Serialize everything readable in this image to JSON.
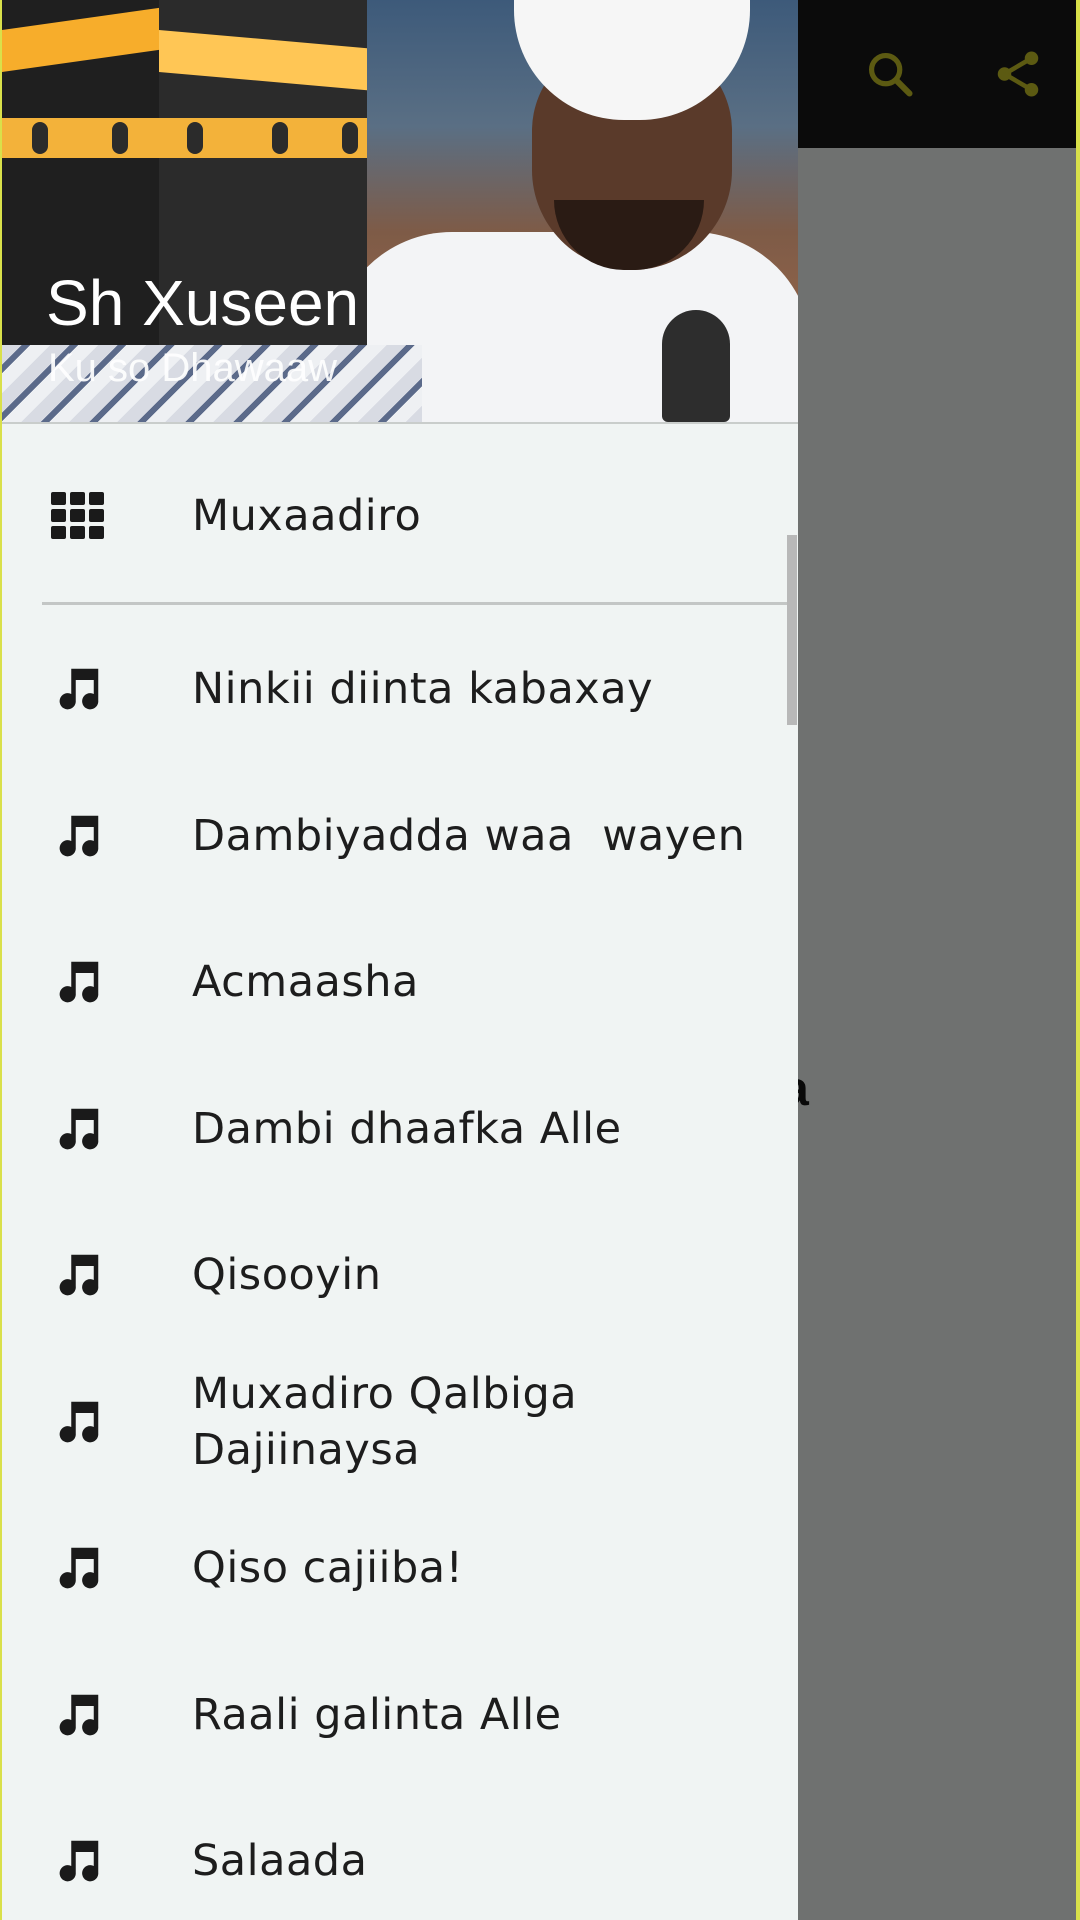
{
  "header": {
    "title": "Sh Xuseen",
    "subtitle": "Ku so Dhawaaw"
  },
  "appbar": {
    "actions": [
      {
        "icon": "search-icon"
      },
      {
        "icon": "share-icon"
      }
    ]
  },
  "background": {
    "partial_text": "aysa"
  },
  "menu": {
    "category": {
      "label": "Muxaadiro",
      "icon": "grid-icon"
    },
    "items": [
      {
        "label": "Ninkii diinta kabaxay",
        "icon": "music-note-icon"
      },
      {
        "label": "Dambiyadda waa  wayen",
        "icon": "music-note-icon"
      },
      {
        "label": "Acmaasha",
        "icon": "music-note-icon"
      },
      {
        "label": "Dambi dhaafka Alle",
        "icon": "music-note-icon"
      },
      {
        "label": "Qisooyin",
        "icon": "music-note-icon"
      },
      {
        "label": "Muxadiro Qalbiga Dajiinaysa",
        "icon": "music-note-icon"
      },
      {
        "label": "Qiso cajiiba!",
        "icon": "music-note-icon"
      },
      {
        "label": "Raali galinta Alle",
        "icon": "music-note-icon"
      },
      {
        "label": "Salaada",
        "icon": "music-note-icon"
      }
    ]
  },
  "colors": {
    "frame": "#d9e04a",
    "drawer_bg": "#f0f4f3",
    "scrim": "#6f7170",
    "appbar_bg": "#0b0b0b",
    "appbar_icon": "#5c5a12",
    "text": "#1d1d1d"
  }
}
